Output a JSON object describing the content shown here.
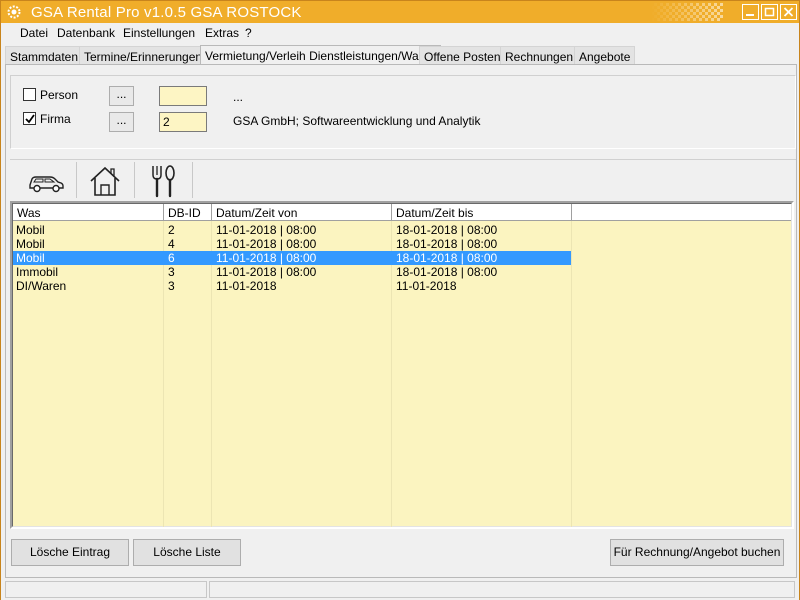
{
  "window": {
    "title": "GSA Rental Pro v1.0.5  GSA ROSTOCK",
    "accent_color": "#f0ad2a"
  },
  "menu": {
    "items": [
      "Datei",
      "Datenbank",
      "Einstellungen",
      "Extras",
      "?"
    ]
  },
  "tabs": [
    "Stammdaten",
    "Termine/Erinnerungen",
    "Vermietung/Verleih Dienstleistungen/Waren",
    "Offene Posten",
    "Rechnungen",
    "Angebote"
  ],
  "active_tab": "Vermietung/Verleih Dienstleistungen/Waren",
  "entity": {
    "person": {
      "label": "Person",
      "checked": false,
      "button": "...",
      "id": "",
      "description": "..."
    },
    "firma": {
      "label": "Firma",
      "checked": true,
      "button": "...",
      "id": "2",
      "description": "GSA GmbH; Softwareentwicklung und Analytik"
    }
  },
  "toolbar": {
    "icons": [
      "car-icon",
      "house-icon",
      "cutlery-icon"
    ]
  },
  "list": {
    "columns": [
      "Was",
      "DB-ID",
      "Datum/Zeit von",
      "Datum/Zeit bis"
    ],
    "rows": [
      [
        "Mobil",
        "2",
        "11-01-2018 | 08:00",
        "18-01-2018 | 08:00"
      ],
      [
        "Mobil",
        "4",
        "11-01-2018 | 08:00",
        "18-01-2018 | 08:00"
      ],
      [
        "Mobil",
        "6",
        "11-01-2018 | 08:00",
        "18-01-2018 | 08:00"
      ],
      [
        "Immobil",
        "3",
        "11-01-2018 | 08:00",
        "18-01-2018 | 08:00"
      ],
      [
        "DI/Waren",
        "3",
        "11-01-2018",
        "11-01-2018"
      ]
    ],
    "selected_index": 2,
    "row_background": "#fbf4c0",
    "selection_color": "#3399ff"
  },
  "buttons": {
    "delete_entry": "Lösche Eintrag",
    "delete_list": "Lösche Liste",
    "book": "Für Rechnung/Angebot buchen"
  }
}
